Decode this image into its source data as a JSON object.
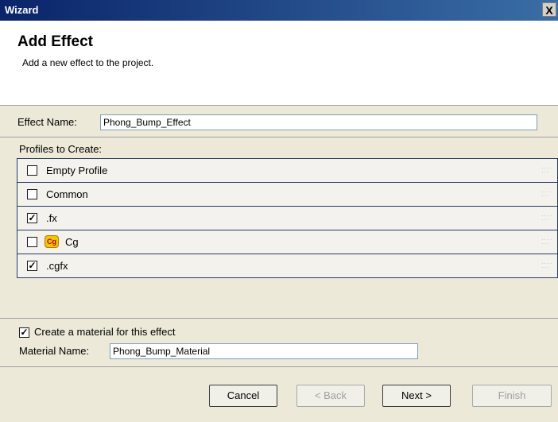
{
  "window": {
    "title": "Wizard",
    "close_label": "X"
  },
  "header": {
    "title": "Add Effect",
    "subtitle": "Add a new effect to the project."
  },
  "effect_name": {
    "label": "Effect Name:",
    "value": "Phong_Bump_Effect"
  },
  "profiles": {
    "label": "Profiles to Create:",
    "items": [
      {
        "label": "Empty Profile",
        "checked": false
      },
      {
        "label": "Common",
        "checked": false
      },
      {
        "label": ".fx",
        "checked": true
      },
      {
        "label": "Cg",
        "checked": false,
        "icon": "cg-icon"
      },
      {
        "label": ".cgfx",
        "checked": true
      }
    ]
  },
  "material": {
    "create_label": "Create a material for this effect",
    "create_checked": true,
    "name_label": "Material Name:",
    "name_value": "Phong_Bump_Material"
  },
  "buttons": {
    "cancel": "Cancel",
    "back": "< Back",
    "next": "Next >",
    "finish": "Finish"
  },
  "icons": {
    "cg_text": "Cg",
    "check_mark": "✓"
  }
}
